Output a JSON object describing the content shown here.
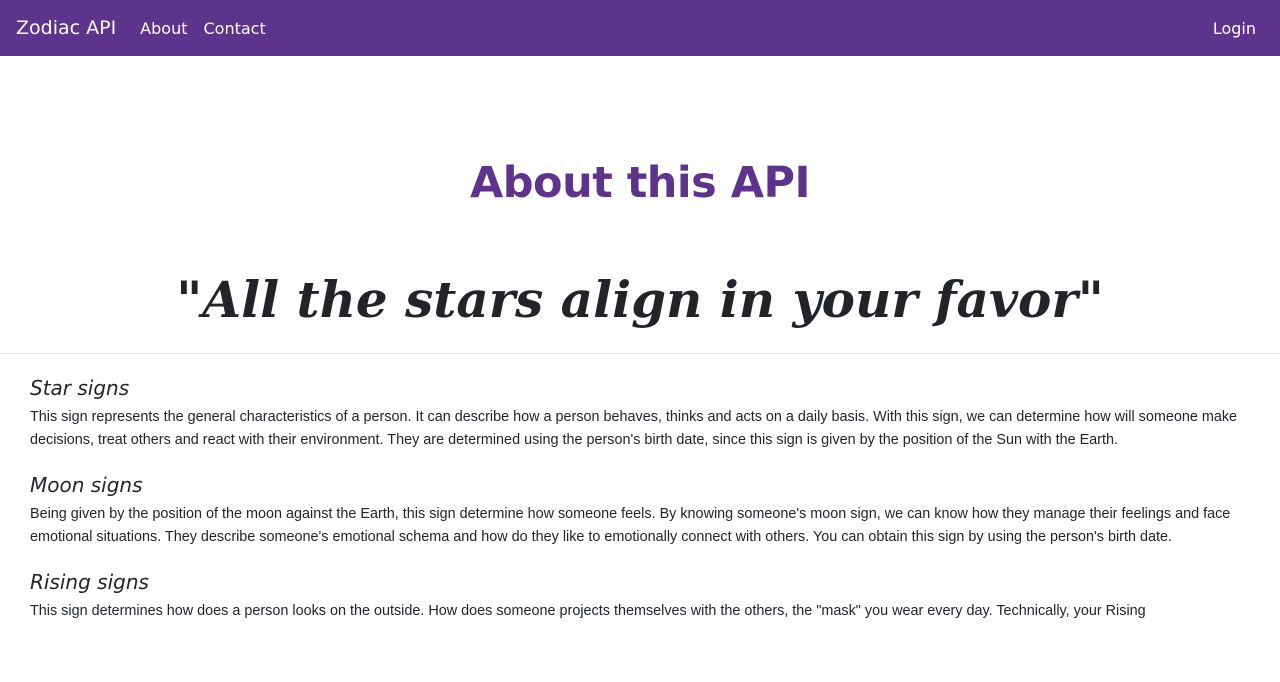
{
  "nav": {
    "brand": "Zodiac API",
    "links": [
      "About",
      "Contact"
    ],
    "login": "Login"
  },
  "hero": {
    "title": "About this API",
    "quote": "\"All the stars align in your favor\""
  },
  "sections": [
    {
      "title": "Star signs",
      "text": "This sign represents the general characteristics of a person. It can describe how a person behaves, thinks and acts on a daily basis. With this sign, we can determine how will someone make decisions, treat others and react with their environment. They are determined using the person's birth date, since this sign is given by the position of the Sun with the Earth."
    },
    {
      "title": "Moon signs",
      "text": "Being given by the position of the moon against the Earth, this sign determine how someone feels. By knowing someone's moon sign, we can know how they manage their feelings and face emotional situations. They describe someone's emotional schema and how do they like to emotionally connect with others. You can obtain this sign by using the person's birth date."
    },
    {
      "title": "Rising signs",
      "text": "This sign determines how does a person looks on the outside. How does someone projects themselves with the others, the \"mask\" you wear every day. Technically, your Rising"
    }
  ],
  "colors": {
    "brand": "#5e338c",
    "text": "#212529"
  }
}
